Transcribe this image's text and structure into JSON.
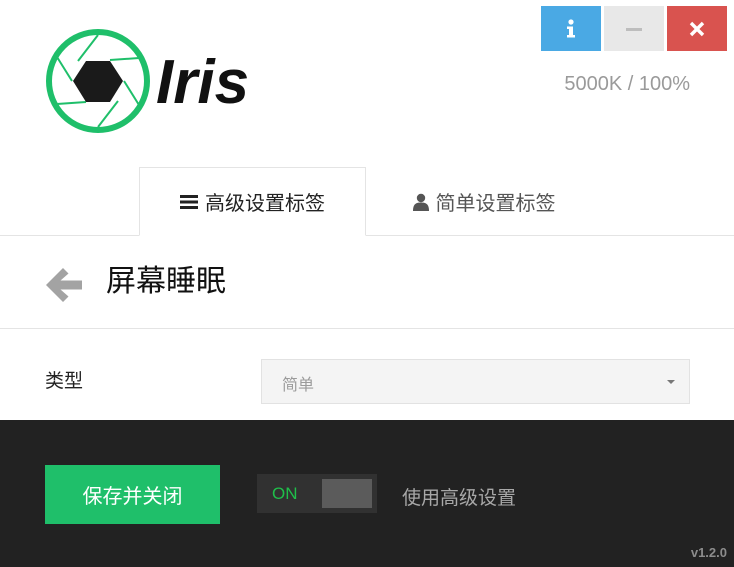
{
  "window_controls": {
    "info": {
      "icon": "info-icon",
      "color": "#4aa9e4"
    },
    "minimize": {
      "icon": "minimize-icon",
      "color": "#e8e8e8"
    },
    "close": {
      "icon": "close-icon",
      "color": "#d9534f"
    }
  },
  "logo": {
    "text": "Iris",
    "ring_color": "#1fbf6a",
    "icon": "aperture-icon"
  },
  "readout": "5000K / 100%",
  "tabs": [
    {
      "label": "高级设置标签",
      "icon": "menu-icon",
      "active": true
    },
    {
      "label": "简单设置标签",
      "icon": "user-icon",
      "active": false
    }
  ],
  "header": {
    "back_icon": "arrow-left-icon",
    "title": "屏幕睡眠"
  },
  "form": {
    "type_label": "类型",
    "type_value": "简单"
  },
  "footer": {
    "save_label": "保存并关闭",
    "toggle_state": "ON",
    "toggle_label": "使用高级设置",
    "version": "v1.2.0",
    "accent": "#1fbf6a"
  }
}
